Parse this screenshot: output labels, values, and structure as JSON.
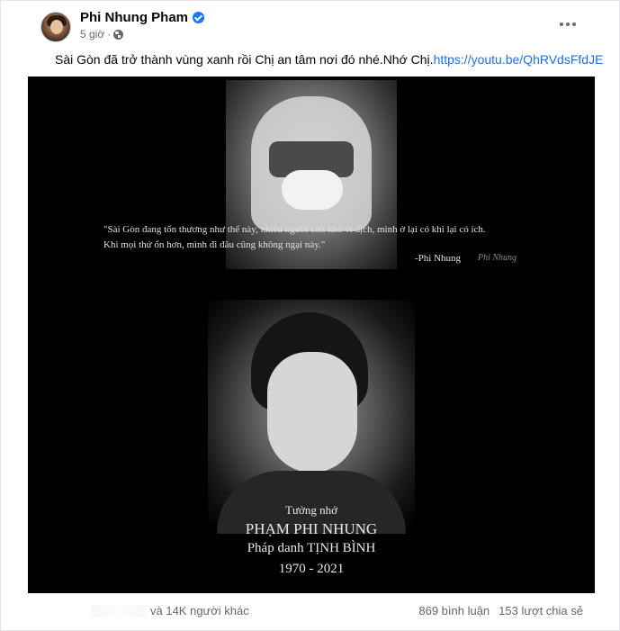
{
  "post": {
    "author": "Phi Nhung Pham",
    "time": "5 giờ",
    "separator": "·",
    "text": "Sài Gòn đã trở thành vùng xanh rồi Chị an tâm nơi đó nhé.Nhớ Chị.",
    "link": "https://youtu.be/QhRVdsFfdJE",
    "avatar_icon": "profile-photo",
    "verified_icon": "verified-badge-icon",
    "privacy_icon": "globe-icon",
    "more_icon": "more-options-icon"
  },
  "image": {
    "quote_line1": "\"Sài Gòn đang tổn thương như thế này, nhiều người còn khổ vì dịch, mình ở lại có khi lại có ích.",
    "quote_line2": "Khi mọi thứ ổn hơn, mình đi đâu cũng không ngại này.\"",
    "quote_author": "-Phi Nhung",
    "signature": "Phi Nhung",
    "memorial_line1": "Tưởng nhớ",
    "memorial_line2": "PHẠM PHI NHUNG",
    "memorial_line3": "Pháp danh TỊNH BÌNH",
    "memorial_line4": "1970 - 2021"
  },
  "footer": {
    "reactions_text": "và 14K người khác",
    "comments": "869 bình luận",
    "shares": "153 lượt chia sẻ"
  },
  "colors": {
    "link": "#216fdb",
    "verified": "#1877f2",
    "secondary_text": "#65676b",
    "image_background": "#000000"
  }
}
